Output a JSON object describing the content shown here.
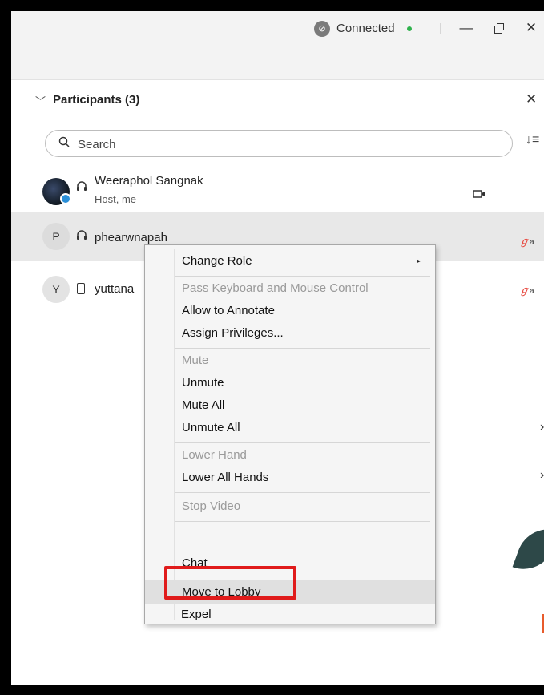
{
  "titlebar": {
    "connection_status": "Connected",
    "status_color": "#2fb24c",
    "separator": "|",
    "minimize_glyph": "—",
    "close_glyph": "✕"
  },
  "participants": {
    "title": "Participants (3)",
    "close_glyph": "✕",
    "search_placeholder": "Search",
    "sort_glyph": "↓≡",
    "list": [
      {
        "name": "Weeraphol Sangnak",
        "subtitle": "Host, me",
        "audio": "headset-icon",
        "video": true
      },
      {
        "initial": "P",
        "name": "phearwnapah",
        "audio": "headset-icon",
        "muted": true,
        "selected": true
      },
      {
        "initial": "Y",
        "name": "yuttana",
        "audio": "phone-icon",
        "muted": true
      }
    ],
    "mute_glyph": "ℊ",
    "lock_glyph": "a"
  },
  "context_menu": {
    "items": [
      {
        "label": "Change Role",
        "disabled": false,
        "submenu": true
      },
      {
        "label": "Pass Keyboard and Mouse Control",
        "disabled": true
      },
      {
        "label": "Allow to Annotate",
        "disabled": false
      },
      {
        "label": "Assign Privileges...",
        "disabled": false
      },
      {
        "label": "Mute",
        "disabled": true
      },
      {
        "label": "Unmute",
        "disabled": false
      },
      {
        "label": "Mute All",
        "disabled": false
      },
      {
        "label": "Unmute All",
        "disabled": false
      },
      {
        "label": "Lower Hand",
        "disabled": true
      },
      {
        "label": "Lower All Hands",
        "disabled": false
      },
      {
        "label": "Stop Video",
        "disabled": true
      },
      {
        "label": "Chat",
        "disabled": false
      },
      {
        "label": "Move to Lobby",
        "disabled": false,
        "highlighted": true
      },
      {
        "label": "Expel",
        "disabled": false
      }
    ],
    "submenu_arrow": "▸",
    "highlight_color": "#e01b1b"
  }
}
